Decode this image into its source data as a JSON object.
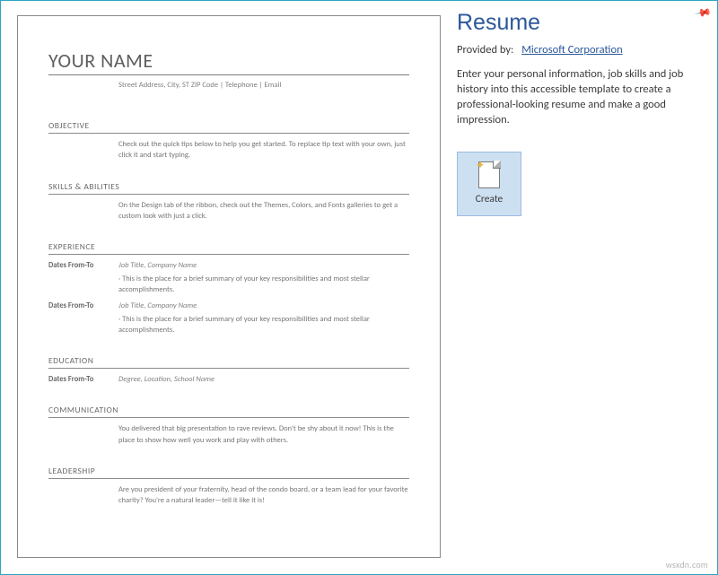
{
  "info": {
    "title": "Resume",
    "provided_label": "Provided by:",
    "provider_link": "Microsoft Corporation",
    "description": "Enter your personal information, job skills and job history into this accessible template to create a professional-looking resume and make a good impression.",
    "create_label": "Create"
  },
  "watermark": "wsxdn.com",
  "doc": {
    "name": "YOUR NAME",
    "contact": "Street Address, City, ST ZIP Code | Telephone | Email",
    "sections": {
      "objective": {
        "heading": "OBJECTIVE",
        "body": "Check out the quick tips below to help you get started. To replace tip text with your own, just click it and start typing."
      },
      "skills": {
        "heading": "SKILLS & ABILITIES",
        "body": "On the Design tab of the ribbon, check out the Themes, Colors, and Fonts galleries to get a custom look with just a click."
      },
      "experience": {
        "heading": "EXPERIENCE",
        "entries": [
          {
            "dates": "Dates From-To",
            "title_line": "Job Title,  Company Name",
            "desc": "· This is the place for a brief summary of your key responsibilities and most stellar accomplishments."
          },
          {
            "dates": "Dates From-To",
            "title_line": "Job Title,  Company Name",
            "desc": "· This is the place for a brief summary of your key responsibilities and most stellar accomplishments."
          }
        ]
      },
      "education": {
        "heading": "EDUCATION",
        "entry": {
          "dates": "Dates From-To",
          "line": "Degree,  Location,  School Name"
        }
      },
      "communication": {
        "heading": "COMMUNICATION",
        "body": "You delivered that big presentation to rave reviews. Don't be shy about it now! This is the place to show how well you work and play with others."
      },
      "leadership": {
        "heading": "LEADERSHIP",
        "body": "Are you president of your fraternity, head of the condo board, or a team lead for your favorite charity? You're a natural leader—tell it like it is!"
      }
    }
  }
}
